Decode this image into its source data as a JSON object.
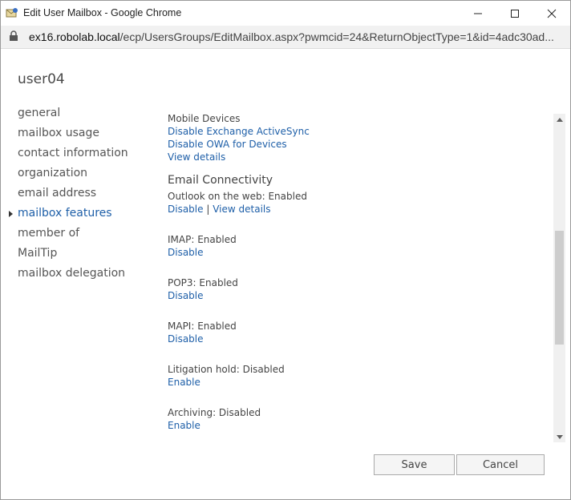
{
  "window": {
    "title": "Edit User Mailbox - Google Chrome",
    "icons": [
      "mailbox-icon",
      "minimize-icon",
      "maximize-icon",
      "close-icon"
    ]
  },
  "address": {
    "host": "ex16.robolab.local",
    "path": "/ecp/UsersGroups/EditMailbox.aspx?pwmcid=24&ReturnObjectType=1&id=4adc30ad..."
  },
  "page": {
    "title": "user04"
  },
  "nav": {
    "items": [
      {
        "label": "general"
      },
      {
        "label": "mailbox usage"
      },
      {
        "label": "contact information"
      },
      {
        "label": "organization"
      },
      {
        "label": "email address"
      },
      {
        "label": "mailbox features",
        "active": true
      },
      {
        "label": "member of"
      },
      {
        "label": "MailTip"
      },
      {
        "label": "mailbox delegation"
      }
    ]
  },
  "features": {
    "mobile_devices": {
      "heading": "Mobile Devices",
      "disable_eas": "Disable Exchange ActiveSync",
      "disable_owa_devices": "Disable OWA for Devices",
      "view_details": "View details"
    },
    "email_connectivity": {
      "heading": "Email Connectivity",
      "owa_status": "Outlook on the web: Enabled",
      "owa_disable": "Disable",
      "separator": "|",
      "owa_view_details": "View details"
    },
    "imap": {
      "status": "IMAP: Enabled",
      "action": "Disable"
    },
    "pop3": {
      "status": "POP3: Enabled",
      "action": "Disable"
    },
    "mapi": {
      "status": "MAPI: Enabled",
      "action": "Disable"
    },
    "litigation": {
      "status": "Litigation hold: Disabled",
      "action": "Enable"
    },
    "archiving": {
      "status": "Archiving: Disabled",
      "action": "Enable"
    }
  },
  "scroll": {
    "position_fraction": 0.55
  },
  "buttons": {
    "save": "Save",
    "cancel": "Cancel"
  },
  "colors": {
    "link": "#1e5fa8",
    "text": "#444444"
  }
}
